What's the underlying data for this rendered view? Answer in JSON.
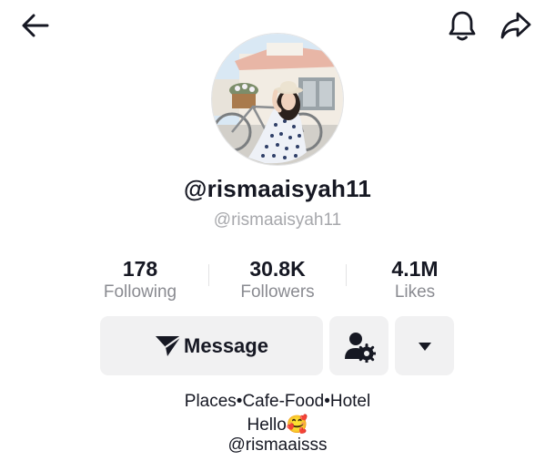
{
  "topbar": {
    "back_icon": "arrow-left-icon",
    "notification_icon": "bell-icon",
    "share_icon": "share-arrow-icon"
  },
  "profile": {
    "avatar_icon": "profile-photo",
    "username": "@rismaaisyah11",
    "handle": "@rismaaisyah11"
  },
  "stats": [
    {
      "value": "178",
      "label": "Following"
    },
    {
      "value": "30.8K",
      "label": "Followers"
    },
    {
      "value": "4.1M",
      "label": "Likes"
    }
  ],
  "actions": {
    "message_label": "Message",
    "message_icon": "paper-plane-icon",
    "friends_icon": "person-gear-icon",
    "more_icon": "caret-down-icon"
  },
  "bio": {
    "line1": "Places•Cafe-Food•Hotel",
    "line2": "Hello🥰",
    "line3": "@rismaaisss"
  }
}
